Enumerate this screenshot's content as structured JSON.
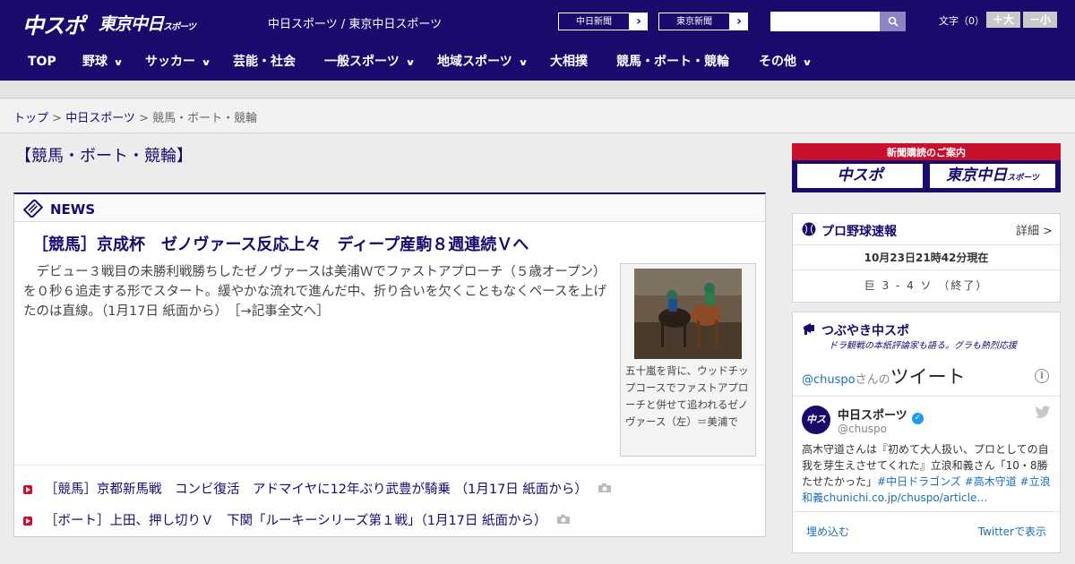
{
  "header": {
    "logo_chuspo": "中スポ",
    "logo_tokyo": "東京中日",
    "logo_tokyo_sub": "スポーツ",
    "site_links": "中日スポーツ / 東京中日スポーツ",
    "btn_chunichi": "中日新聞",
    "btn_tokyo": "東京新聞",
    "btn_arrow": "›",
    "search_placeholder": "",
    "fontsize_label": "文字（0）",
    "fontsize_up": "＋大",
    "fontsize_down": "－小"
  },
  "nav": {
    "items": [
      {
        "label": "TOP"
      },
      {
        "label": "野球"
      },
      {
        "label": "サッカー"
      },
      {
        "label": "芸能・社会"
      },
      {
        "label": "一般スポーツ"
      },
      {
        "label": "地域スポーツ"
      },
      {
        "label": "大相撲"
      },
      {
        "label": "競馬・ボート・競輪"
      },
      {
        "label": "その他"
      }
    ]
  },
  "breadcrumb": {
    "home": "トップ",
    "sep": " > ",
    "section": "中日スポーツ",
    "current": "競馬・ボート・競輪"
  },
  "page_title": "【競馬・ボート・競輪】",
  "news": {
    "label": "NEWS",
    "headline": "［競馬］京成杯　ゼノヴァース反応上々　ディープ産駒８週連続Ｖへ",
    "lead": "　デビュー３戦目の未勝利戦勝ちしたゼノヴァースは美浦Ｗでファストアプローチ（５歳オープン）を０秒６追走する形でスタート。緩やかな流れで進んだ中、折り合いを欠くこともなくペースを上げたのは直線。（1月17日 紙面から）",
    "lead_more": "［→記事全文へ］",
    "photo_caption": "五十嵐を背に、ウッドチップコースでファストアプローチと併せて追われるゼノヴァース（左）＝美浦で",
    "list": [
      {
        "text": "［競馬］京都新馬戦　コンビ復活　アドマイヤに12年ぶり武豊が騎乗 （1月17日 紙面から）"
      },
      {
        "text": "［ボート］上田、押し切りＶ　下関「ルーキーシリーズ第１戦」（1月17日 紙面から）"
      }
    ]
  },
  "sidebar": {
    "subscribe_title": "新聞購読のご案内",
    "subscribe_chuspo": "中スポ",
    "subscribe_tokyo": "東京中日",
    "subscribe_tokyo_sub": "スポーツ",
    "baseball": {
      "title": "プロ野球速報",
      "detail": "詳細 >",
      "time": "10月23日21時42分現在",
      "score": "巨 3 - 4 ソ （終了）"
    },
    "twitter": {
      "title": "つぶやき中スポ",
      "subtitle": "ドラ観戦の本紙評論家も語る。グラも熱烈応援",
      "heading_handle": "@chuspo",
      "heading_san": "さんの",
      "heading_tweet": "ツイート",
      "name": "中日スポーツ",
      "handle": "@chuspo",
      "avatar_text": "中スポ",
      "text": "高木守道さんは『初めて大人扱い、プロとしての自我を芽生えさせてくれた』立浪和義さん「10・8勝たせたかった」",
      "text_links": "#中日ドラゴンズ #高木守道 #立浪和義chunichi.co.jp/chuspo/article…",
      "embed": "埋め込む",
      "view": "Twitterで表示"
    }
  },
  "colors": {
    "brand": "#1b0a6c",
    "accent_red": "#c8102e",
    "link_blue": "#1b6fb8"
  }
}
